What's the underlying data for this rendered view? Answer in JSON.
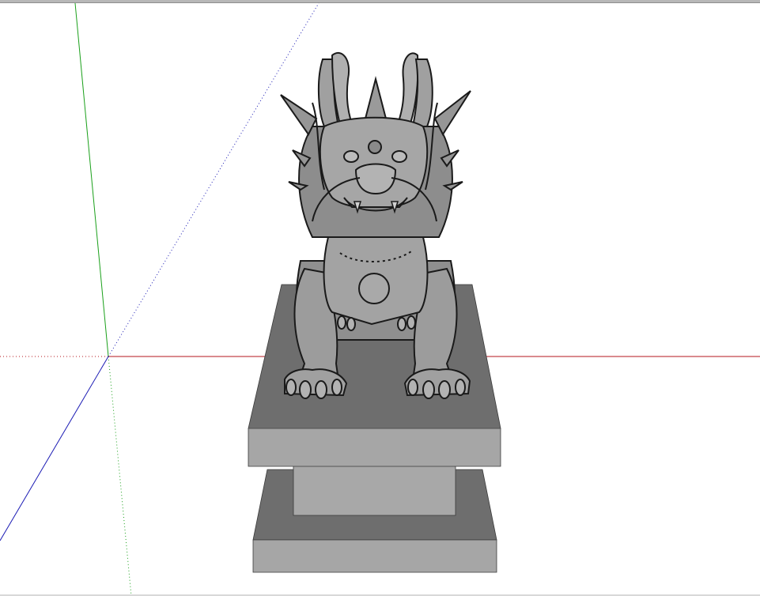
{
  "viewport": {
    "background": "#ffffff",
    "axis_colors": {
      "red": "#b4161e",
      "green": "#1aa01a",
      "blue": "#1b1bb4"
    }
  },
  "model": {
    "name_icon": "dragon-statue-3d-model",
    "fill_light": "#a6a6a6",
    "fill_mid": "#8c8c8c",
    "fill_dark": "#6e6e6e",
    "edge": "#1a1a1a"
  }
}
